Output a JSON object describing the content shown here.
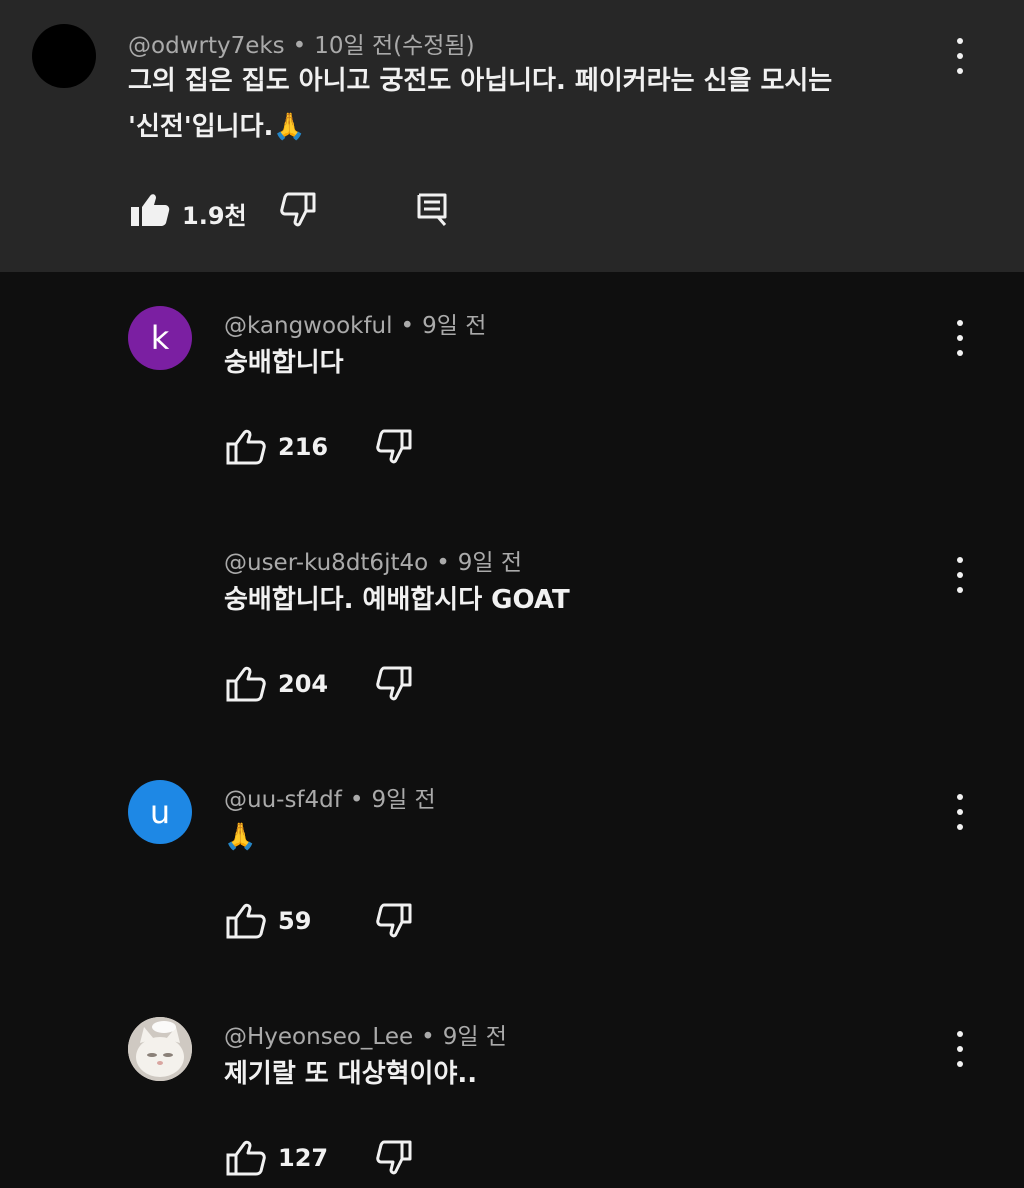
{
  "top_comment": {
    "handle": "@odwrty7eks",
    "separator": "•",
    "time": "10일 전(수정됨)",
    "text_line1": "그의 집은 집도 아니고 궁전도 아닙니다. 페이커라는 신을 모시는",
    "text_line2": "'신전'입니다.🙏",
    "likes": "1.9천"
  },
  "replies": [
    {
      "avatar_letter": "k",
      "avatar_color": "#7b1fa2",
      "handle": "@kangwookful",
      "separator": "•",
      "time": "9일 전",
      "text": "숭배합니다",
      "likes": "216"
    },
    {
      "handle": "@user-ku8dt6jt4o",
      "separator": "•",
      "time": "9일 전",
      "text": "숭배합니다. 예배합시다 GOAT",
      "likes": "204"
    },
    {
      "avatar_letter": "u",
      "avatar_color": "#1e88e5",
      "handle": "@uu-sf4df",
      "separator": "•",
      "time": "9일 전",
      "text": "🙏",
      "likes": "59"
    },
    {
      "handle": "@Hyeonseo_Lee",
      "separator": "•",
      "time": "9일 전",
      "text": "제기랄 또 대상혁이야..",
      "likes": "127"
    }
  ],
  "icons": {
    "like": "thumb-up-icon",
    "dislike": "thumb-down-icon",
    "reply": "comment-icon",
    "more": "more-vert-icon"
  }
}
